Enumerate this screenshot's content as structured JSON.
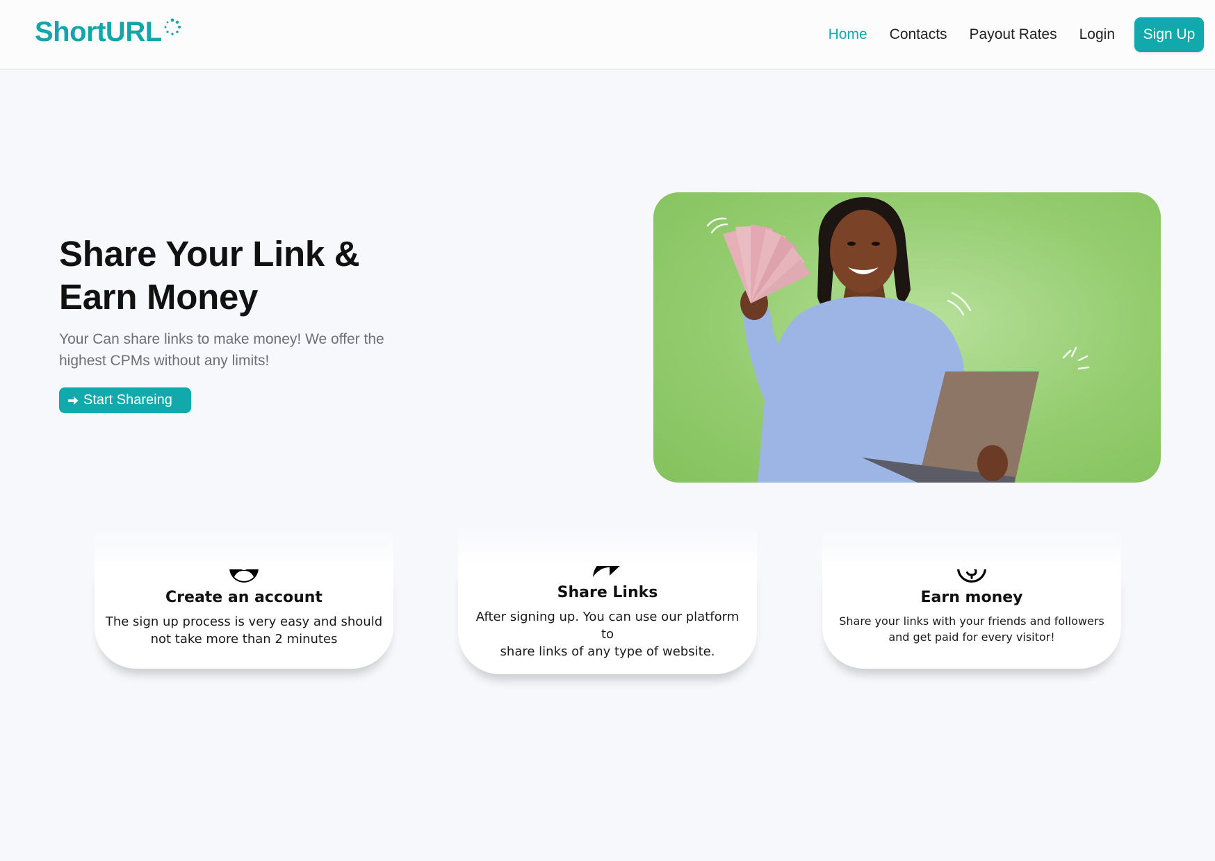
{
  "brand": {
    "name": "ShortURL",
    "color": "#12a6ac"
  },
  "nav": {
    "links": [
      {
        "label": "Home",
        "active": true
      },
      {
        "label": "Contacts",
        "active": false
      },
      {
        "label": "Payout Rates",
        "active": false
      },
      {
        "label": "Login",
        "active": false
      }
    ],
    "signup_label": "Sign Up"
  },
  "hero": {
    "title_line1": "Share Your Link &",
    "title_line2": "Earn Money",
    "subtitle_line1": "Your Can share links to make money! We offer the",
    "subtitle_line2": "highest CPMs without any limits!",
    "cta_label": "Start Shareing",
    "cta_icon": "arrow-right-icon"
  },
  "features": [
    {
      "icon": "user-circle-icon",
      "title": "Create an account",
      "desc_line1": "The sign up process is very easy and should",
      "desc_line2": "not take more than 2 minutes"
    },
    {
      "icon": "share-arrow-icon",
      "title": "Share Links",
      "desc_line1": "After signing up. You can use our platform to",
      "desc_line2": "share links of any type of website."
    },
    {
      "icon": "dollar-circle-icon",
      "title": "Earn money",
      "desc_line1": "Share your links with your friends and followers",
      "desc_line2": "and get paid for every visitor!"
    }
  ],
  "colors": {
    "accent": "#12a9ad",
    "background": "#f7f8fc",
    "hero_image_bg": "#94cc6f"
  }
}
